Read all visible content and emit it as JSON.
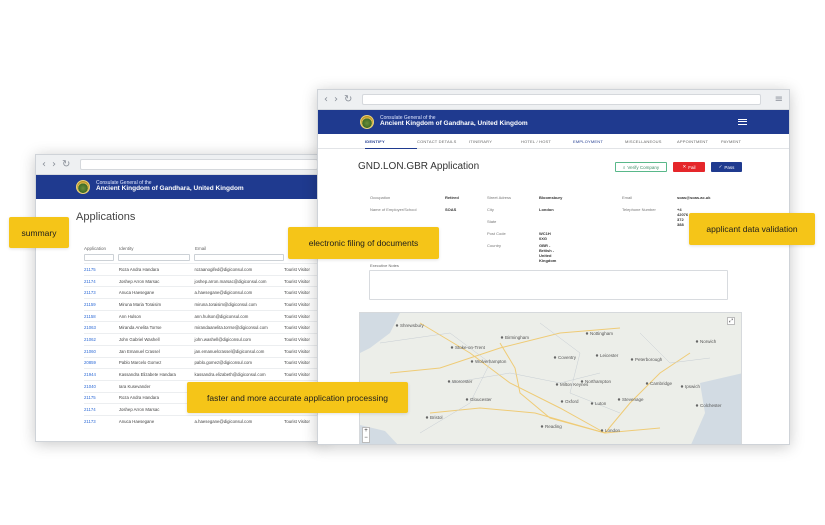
{
  "left_window": {
    "brand": {
      "line1": "Consulate General of the",
      "line2": "Ancient Kingdom of Gandhara, United Kingdom"
    },
    "page_title": "Applications",
    "columns": [
      "Application",
      "Identity",
      "Email"
    ],
    "rows": [
      {
        "id": "21175",
        "name": "Roza Andra Handara",
        "email": "rozaanogifed@digiconsul.com",
        "type": "Tourist Visitor"
      },
      {
        "id": "21174",
        "name": "Joshep Arron Marsac",
        "email": "joshep.arron.marsac@digiconsul.com",
        "type": "Tourist Visitor"
      },
      {
        "id": "21173",
        "name": "Anuca Haesegane",
        "email": "a.haesegane@digiconsul.com",
        "type": "Tourist Visitor"
      },
      {
        "id": "21159",
        "name": "Miruna Maria Toraisim",
        "email": "miruna.toraisim@digiconsul.com",
        "type": "Tourist Visitor"
      },
      {
        "id": "21158",
        "name": "Ann Hulson",
        "email": "ann.hulson@digiconsul.com",
        "type": "Tourist Visitor"
      },
      {
        "id": "21063",
        "name": "Miranda Anelita Torrse",
        "email": "mirandaanelita.torrse@digiconsul.com",
        "type": "Tourist Visitor"
      },
      {
        "id": "21062",
        "name": "John Gabriel Washell",
        "email": "john.washell@digiconsul.com",
        "type": "Tourist Visitor"
      },
      {
        "id": "21060",
        "name": "Jan Emanuel Crassel",
        "email": "jan.emanuelcrassel@digiconsul.com",
        "type": "Tourist Visitor"
      },
      {
        "id": "20859",
        "name": "Pablo Marcelo Gomez",
        "email": "pablo.gomez@digiconsul.com",
        "type": "Tourist Visitor"
      },
      {
        "id": "21944",
        "name": "Kassandra Elizabete Handara",
        "email": "kassandra.elizabeth@digiconsul.com",
        "type": "Tourist Visitor"
      },
      {
        "id": "21040",
        "name": "Iara Kusevander",
        "email": "",
        "type": ""
      },
      {
        "id": "21175",
        "name": "Roza Andra Handara",
        "email": "",
        "type": ""
      },
      {
        "id": "21174",
        "name": "Joshep Arron Marsac",
        "email": "",
        "type": ""
      },
      {
        "id": "21173",
        "name": "Anuca Haesegane",
        "email": "a.haesegane@digiconsul.com",
        "type": "Tourist Visitor"
      }
    ]
  },
  "right_window": {
    "brand": {
      "line1": "Consulate General of the",
      "line2": "Ancient Kingdom of Gandhara, United Kingdom"
    },
    "tabs": [
      "IDENTIFY",
      "CONTACT DETAILS",
      "ITINERARY",
      "HOTEL / HOST",
      "EMPLOYMENT",
      "MISCELLANEOUS",
      "APPOINTMENT",
      "PAYMENT"
    ],
    "page_title": "GND.LON.GBR Application",
    "buttons": {
      "verify": "Verify Company",
      "fail": "Fail",
      "pass": "Pass"
    },
    "employment": {
      "occupation_label": "Occupation",
      "occupation": "Retired",
      "employer_label": "Name of Employer/School",
      "employer": "SOAS",
      "street_label": "Street Adress",
      "street": "Bloomsbury",
      "city_label": "City",
      "city": "London",
      "state_label": "State",
      "state": "",
      "postcode_label": "Post Code",
      "postcode": "WC1H 0XG",
      "country_label": "Country",
      "country": "GBR - British - United Kingdom",
      "email_label": "Email",
      "email": "soas@soas.ac.uk",
      "phone_label": "Telephone Number",
      "phone": "+4 42076 372 388"
    },
    "notes_label": "Executive Notes",
    "map": {
      "cities": [
        "Shrewsbury",
        "Stoke-on-Trent",
        "Birmingham",
        "Coventry",
        "Leicester",
        "Nottingham",
        "Peterborough",
        "Norwich",
        "Cambridge",
        "Oxford",
        "Bristol",
        "Gloucester",
        "Northampton",
        "Wolverhampton",
        "Worcester",
        "Ipswich",
        "Colchester",
        "Reading",
        "London",
        "Luton",
        "Milton Keynes",
        "Stevenage"
      ],
      "zoom_in": "+",
      "zoom_out": "−"
    }
  },
  "callouts": {
    "summary": "summary",
    "filing": "electronic filing of documents",
    "validation": "applicant data validation",
    "processing": "faster and more accurate application processing"
  },
  "chrome": {
    "back": "‹",
    "forward": "›",
    "reload": "↻",
    "menu": "≡"
  }
}
